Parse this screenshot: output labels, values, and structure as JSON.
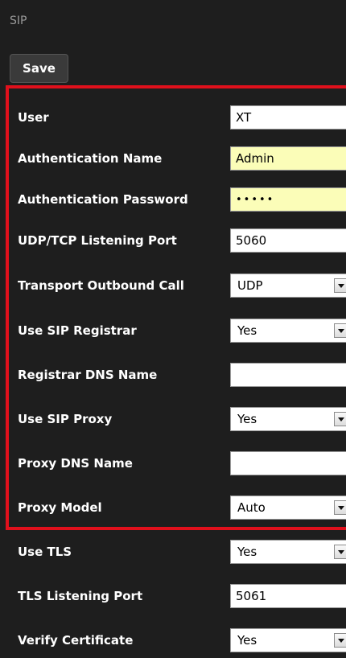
{
  "section": {
    "title": "SIP"
  },
  "toolbar": {
    "save_label": "Save"
  },
  "fields": {
    "user": {
      "label": "User",
      "value": "XT"
    },
    "auth_name": {
      "label": "Authentication Name",
      "value": "Admin"
    },
    "auth_password": {
      "label": "Authentication Password",
      "value": "•••••"
    },
    "listen_port": {
      "label": "UDP/TCP Listening Port",
      "value": "5060"
    },
    "transport": {
      "label": "Transport Outbound Call",
      "value": "UDP"
    },
    "use_registrar": {
      "label": "Use SIP Registrar",
      "value": "Yes"
    },
    "registrar_dns": {
      "label": "Registrar DNS Name",
      "value": ""
    },
    "use_proxy": {
      "label": "Use SIP Proxy",
      "value": "Yes"
    },
    "proxy_dns": {
      "label": "Proxy DNS Name",
      "value": ""
    },
    "proxy_model": {
      "label": "Proxy Model",
      "value": "Auto"
    },
    "use_tls": {
      "label": "Use TLS",
      "value": "Yes"
    },
    "tls_port": {
      "label": "TLS Listening Port",
      "value": "5061"
    },
    "verify_cert": {
      "label": "Verify Certificate",
      "value": "Yes"
    }
  },
  "colors": {
    "background": "#1e1e1e",
    "highlight_border": "#e0101c",
    "autofill": "#fbfdb8"
  },
  "icons": {
    "dropdown": "chevron-down-icon"
  }
}
